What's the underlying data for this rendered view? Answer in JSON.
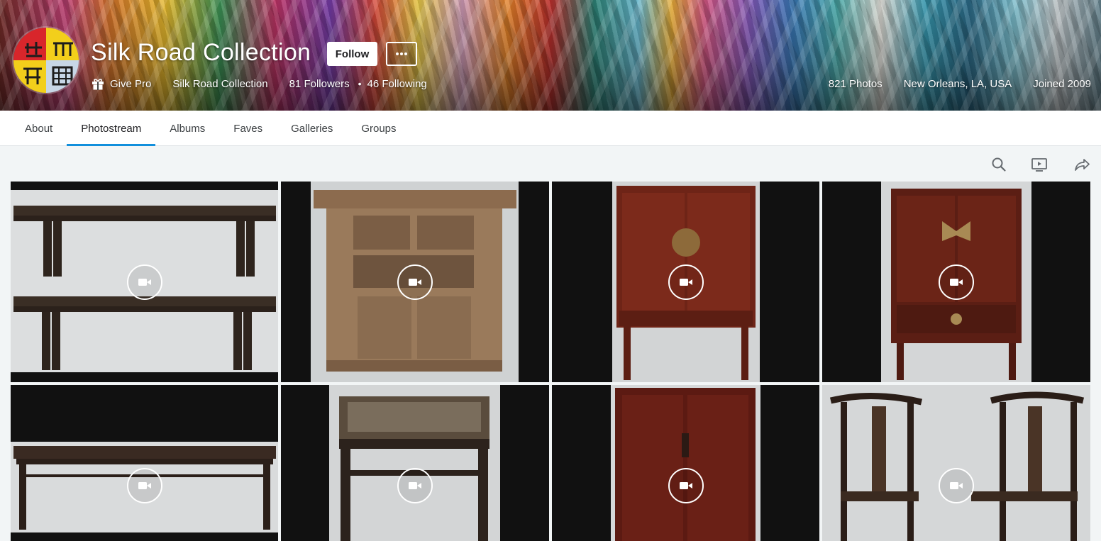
{
  "profile": {
    "name": "Silk Road Collection",
    "follow_label": "Follow",
    "more_label": "•••",
    "give_pro_label": "Give Pro",
    "real_name": "Silk Road Collection",
    "followers": "81 Followers",
    "following": "46 Following",
    "photos_count": "821 Photos",
    "location": "New Orleans, LA, USA",
    "joined": "Joined 2009"
  },
  "tabs": [
    {
      "label": "About",
      "active": false
    },
    {
      "label": "Photostream",
      "active": true
    },
    {
      "label": "Albums",
      "active": false
    },
    {
      "label": "Faves",
      "active": false
    },
    {
      "label": "Galleries",
      "active": false
    },
    {
      "label": "Groups",
      "active": false
    }
  ],
  "toolbar": {
    "icons": [
      "search-icon",
      "slideshow-icon",
      "share-icon"
    ]
  },
  "photos": [
    {
      "subject": "pair-of-benches",
      "type": "video"
    },
    {
      "subject": "carved-chest",
      "type": "video"
    },
    {
      "subject": "red-cabinet-round-lock",
      "type": "video"
    },
    {
      "subject": "red-cabinet-butterfly-lock",
      "type": "video"
    },
    {
      "subject": "long-bench",
      "type": "video"
    },
    {
      "subject": "square-stool",
      "type": "video"
    },
    {
      "subject": "tall-red-cabinet",
      "type": "video"
    },
    {
      "subject": "pair-of-armchairs",
      "type": "video"
    }
  ],
  "colors": {
    "accent": "#128fdc",
    "tile_background": "#111111",
    "page_background": "#f2f5f6"
  }
}
